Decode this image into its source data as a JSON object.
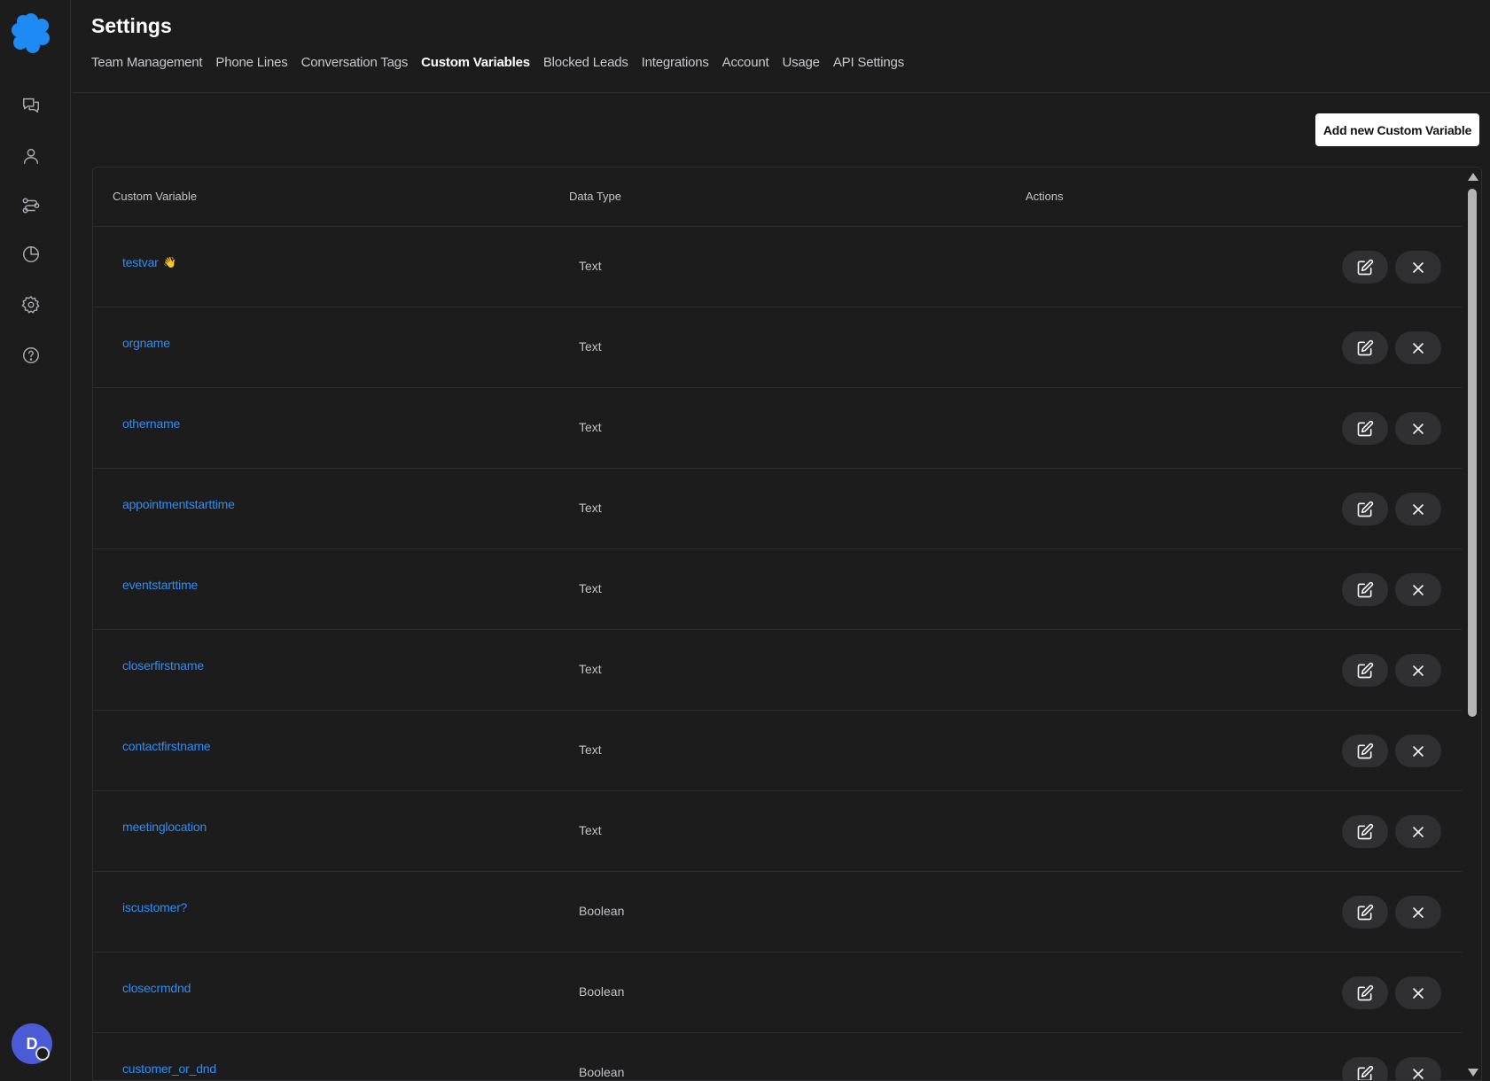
{
  "header": {
    "title": "Settings",
    "tabs": [
      {
        "label": "Team Management",
        "active": false
      },
      {
        "label": "Phone Lines",
        "active": false
      },
      {
        "label": "Conversation Tags",
        "active": false
      },
      {
        "label": "Custom Variables",
        "active": true
      },
      {
        "label": "Blocked Leads",
        "active": false
      },
      {
        "label": "Integrations",
        "active": false
      },
      {
        "label": "Account",
        "active": false
      },
      {
        "label": "Usage",
        "active": false
      },
      {
        "label": "API Settings",
        "active": false
      }
    ]
  },
  "sidebar": {
    "logo": "brand-logo",
    "nav_icons": [
      "conversations-icon",
      "contacts-icon",
      "workflows-icon",
      "analytics-icon",
      "settings-icon",
      "help-icon"
    ],
    "avatar_initial": "D"
  },
  "toolbar": {
    "add_label": "Add new Custom Variable"
  },
  "table": {
    "columns": [
      "Custom Variable",
      "Data Type",
      "Actions"
    ],
    "rows": [
      {
        "name": "testvar",
        "type": "Text",
        "icon": "👋"
      },
      {
        "name": "orgname",
        "type": "Text"
      },
      {
        "name": "othername",
        "type": "Text"
      },
      {
        "name": "appointmentstarttime",
        "type": "Text"
      },
      {
        "name": "eventstarttime",
        "type": "Text"
      },
      {
        "name": "closerfirstname",
        "type": "Text"
      },
      {
        "name": "contactfirstname",
        "type": "Text"
      },
      {
        "name": "meetinglocation",
        "type": "Text"
      },
      {
        "name": "iscustomer?",
        "type": "Boolean"
      },
      {
        "name": "closecrmdnd",
        "type": "Boolean"
      },
      {
        "name": "customer_or_dnd",
        "type": "Boolean"
      }
    ]
  },
  "colors": {
    "background": "#1c1c1d",
    "link": "#2f8cf5",
    "brand": "#1e8bf5",
    "avatar": "#4b5bd6",
    "button_bg": "#303033"
  }
}
